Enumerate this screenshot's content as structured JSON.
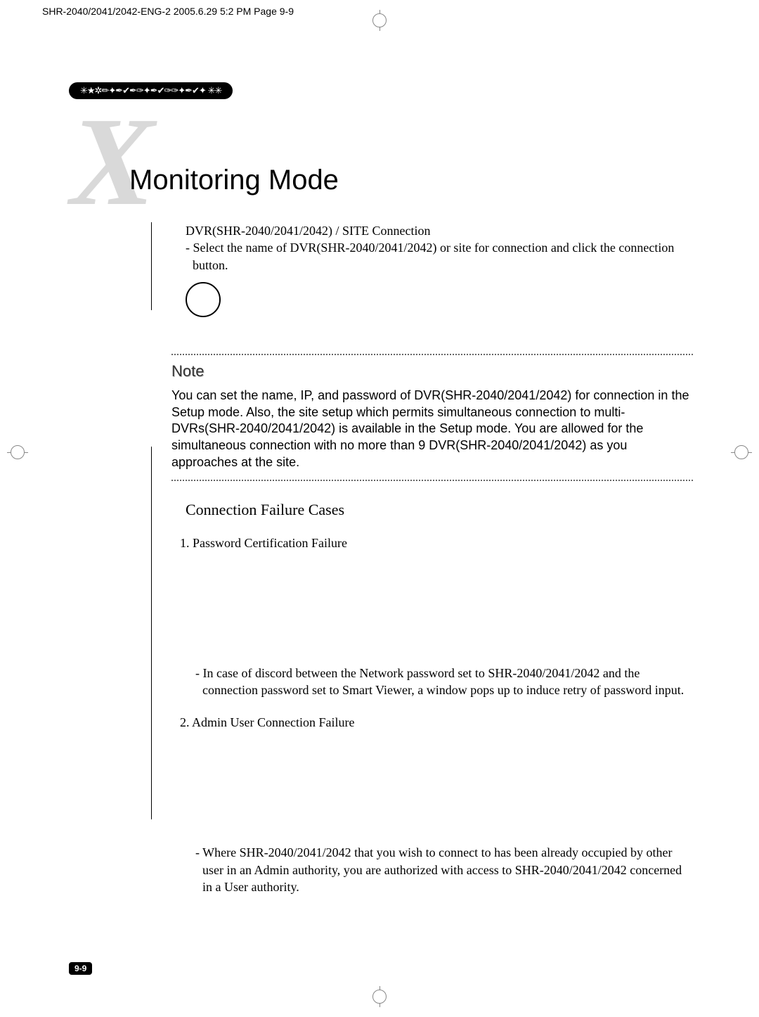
{
  "header": {
    "imprint": "SHR-2040/2041/2042-ENG-2  2005.6.29  5:2 PM  Page 9-9"
  },
  "pill": {
    "glyphs": "✳★✲✏✦✒✔✒✑✦✒✔✑✑✦✒✔✦ ✳✳"
  },
  "chapter": {
    "letter": "X",
    "title": "Monitoring Mode"
  },
  "intro": {
    "line1": "DVR(SHR-2040/2041/2042) / SITE Connection",
    "line2": "- Select the name of DVR(SHR-2040/2041/2042) or site for connection and click the connection button."
  },
  "note": {
    "title": "Note",
    "body": "You can set the name, IP, and password of DVR(SHR-2040/2041/2042) for connection in the Setup mode. Also, the site setup which permits simultaneous connection to multi-DVRs(SHR-2040/2041/2042) is available in the Setup mode. You are allowed for the simultaneous connection with no more than 9 DVR(SHR-2040/2041/2042) as you approaches at the site."
  },
  "section": {
    "heading": "Connection Failure Cases",
    "items": [
      {
        "label": "1. Password Certification Failure",
        "explanation": "- In case of discord between the Network password set to SHR-2040/2041/2042 and the connection password set to Smart Viewer, a window pops up to induce retry of password input."
      },
      {
        "label": "2. Admin User Connection Failure",
        "explanation": "- Where SHR-2040/2041/2042 that you wish to connect to has been already occupied by other user in an Admin authority, you are authorized with access to SHR-2040/2041/2042 concerned in a User authority."
      }
    ]
  },
  "page_number": "9-9"
}
